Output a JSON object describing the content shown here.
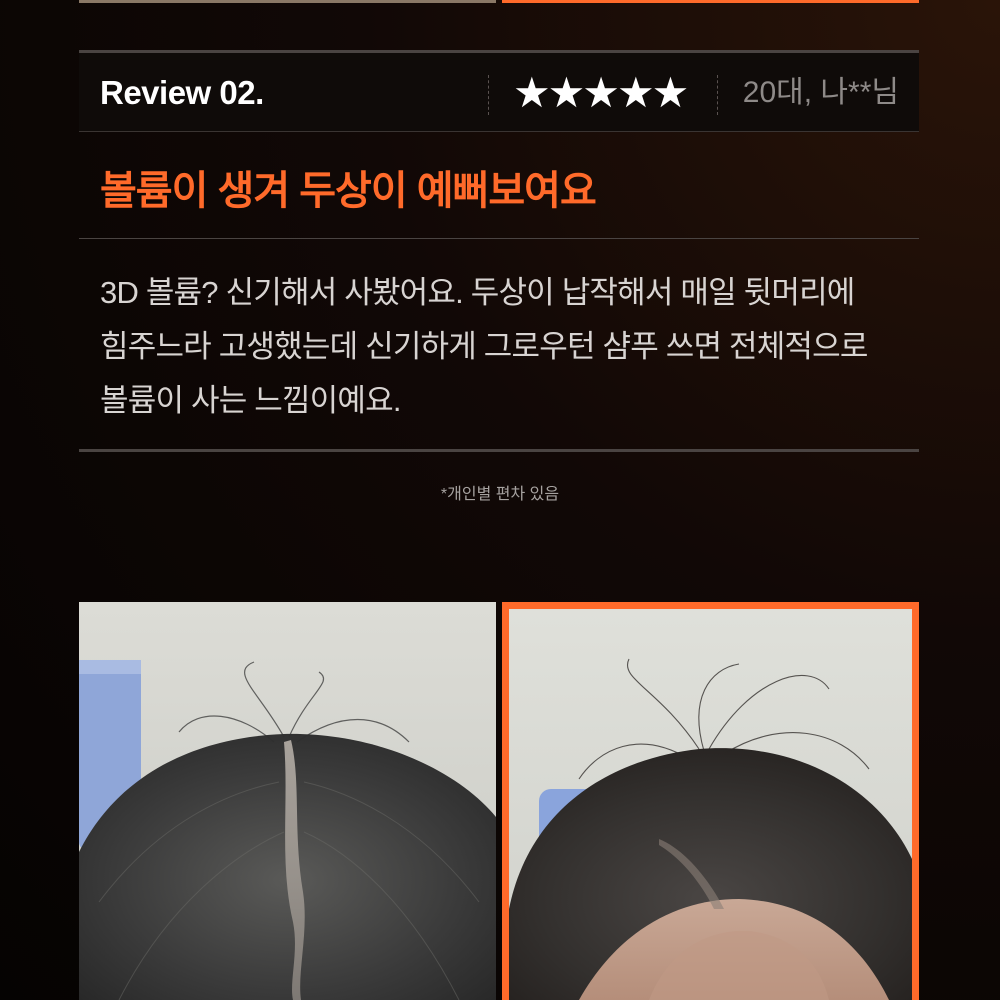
{
  "review": {
    "label": "Review 02.",
    "rating": 5,
    "stars": "★★★★★",
    "reviewer": "20대, 나**님",
    "title": "볼륨이 생겨 두상이 예뻐보여요",
    "body_lines": [
      "3D 볼륨? 신기해서 사봤어요. 두상이 납작해서 매일 뒷머리에",
      "힘주느라 고생했는데 신기하게 그로우턴 샴푸 쓰면 전체적으로",
      "볼륨이 사는 느낌이예요."
    ]
  },
  "disclaimer": "*개인별 편차 있음",
  "colors": {
    "accent": "#ff6a2a",
    "background": "#0a0604",
    "text_muted": "#8e8a88"
  }
}
